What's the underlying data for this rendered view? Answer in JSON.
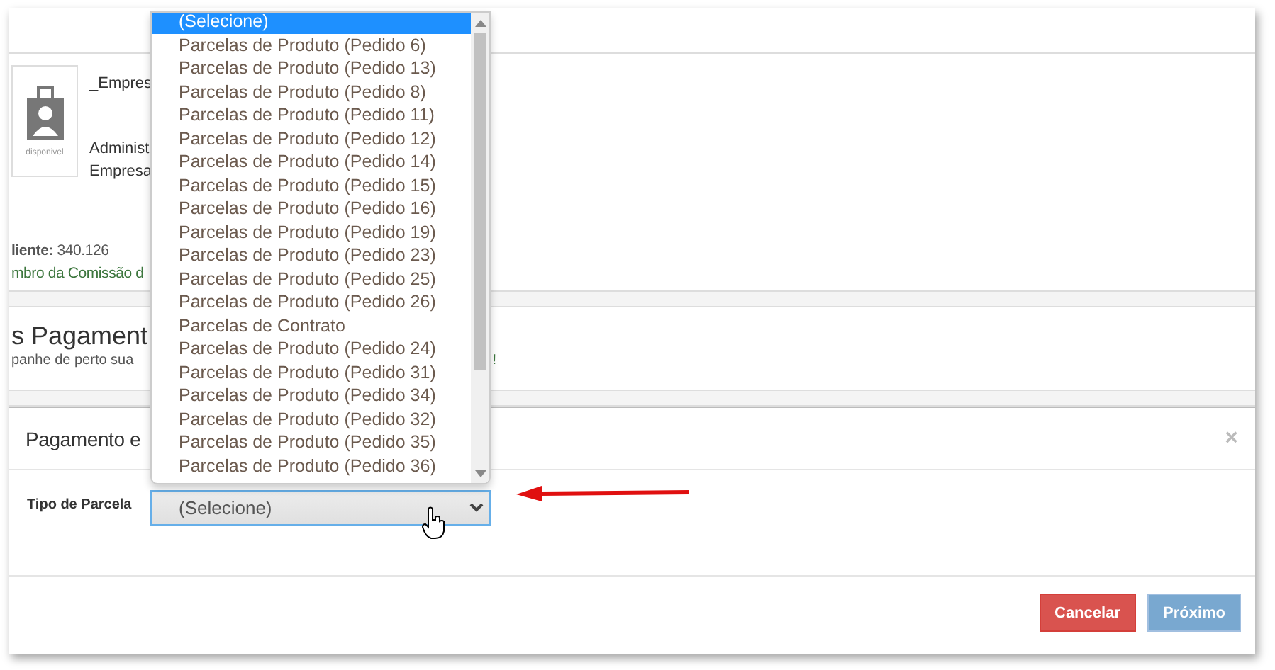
{
  "page": {
    "company_name": "_Empres",
    "role": "Administ",
    "company": "Empresa",
    "avatar_caption": "disponivel",
    "client_label": "liente:",
    "client_id": "340.126",
    "commission": "mbro da Comissão d",
    "section_title": "s Pagament",
    "section_subtitle": "panhe de perto sua",
    "subtitle_end": "!"
  },
  "modal": {
    "title": "Pagamento e",
    "close": "×",
    "field_label": "Tipo de Parcela",
    "select_value": "(Selecione)",
    "buttons": [
      {
        "label": "Cancelar",
        "kind": "danger",
        "disabled": false
      },
      {
        "label": "Próximo",
        "kind": "primary",
        "disabled": true
      }
    ]
  },
  "dropdown": {
    "options": [
      {
        "label": "(Selecione)",
        "selected": true
      },
      {
        "label": "Parcelas de Produto (Pedido 6)",
        "selected": false
      },
      {
        "label": "Parcelas de Produto (Pedido 13)",
        "selected": false
      },
      {
        "label": "Parcelas de Produto (Pedido 8)",
        "selected": false
      },
      {
        "label": "Parcelas de Produto (Pedido 11)",
        "selected": false
      },
      {
        "label": "Parcelas de Produto (Pedido 12)",
        "selected": false
      },
      {
        "label": "Parcelas de Produto (Pedido 14)",
        "selected": false
      },
      {
        "label": "Parcelas de Produto (Pedido 15)",
        "selected": false
      },
      {
        "label": "Parcelas de Produto (Pedido 16)",
        "selected": false
      },
      {
        "label": "Parcelas de Produto (Pedido 19)",
        "selected": false
      },
      {
        "label": "Parcelas de Produto (Pedido 23)",
        "selected": false
      },
      {
        "label": "Parcelas de Produto (Pedido 25)",
        "selected": false
      },
      {
        "label": "Parcelas de Produto (Pedido 26)",
        "selected": false
      },
      {
        "label": "Parcelas de Contrato",
        "selected": false
      },
      {
        "label": "Parcelas de Produto (Pedido 24)",
        "selected": false
      },
      {
        "label": "Parcelas de Produto (Pedido 31)",
        "selected": false
      },
      {
        "label": "Parcelas de Produto (Pedido 34)",
        "selected": false
      },
      {
        "label": "Parcelas de Produto (Pedido 32)",
        "selected": false
      },
      {
        "label": "Parcelas de Produto (Pedido 35)",
        "selected": false
      },
      {
        "label": "Parcelas de Produto (Pedido 36)",
        "selected": false
      }
    ]
  }
}
